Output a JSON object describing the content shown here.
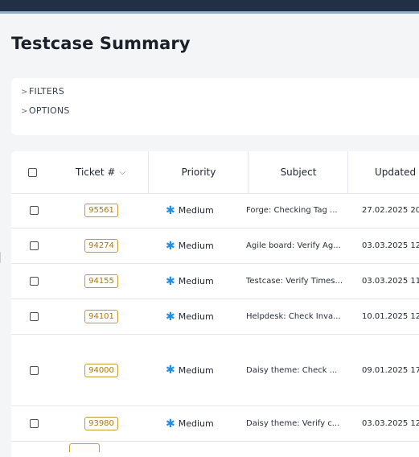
{
  "page": {
    "title": "Testcase Summary"
  },
  "filters": {
    "filters_label": "FILTERS",
    "options_label": "OPTIONS",
    "chevron": ">"
  },
  "table": {
    "columns": {
      "ticket": "Ticket #",
      "priority": "Priority",
      "subject": "Subject",
      "updated": "Updated"
    },
    "sort_icon": "chevron-down-icon",
    "rows": [
      {
        "ticket": "95561",
        "priority": "Medium",
        "subject": "Forge: Checking Tag ...",
        "updated": "27.02.2025 20"
      },
      {
        "ticket": "94274",
        "priority": "Medium",
        "subject": "Agile board: Verify Ag...",
        "updated": "03.03.2025 12"
      },
      {
        "ticket": "94155",
        "priority": "Medium",
        "subject": "Testcase: Verify Times...",
        "updated": "03.03.2025 11:"
      },
      {
        "ticket": "94101",
        "priority": "Medium",
        "subject": "Helpdesk: Check Inva...",
        "updated": "10.01.2025 12:"
      },
      {
        "ticket": "94000",
        "priority": "Medium",
        "subject": "Daisy theme: Check ...",
        "updated": "09.01.2025 17:"
      },
      {
        "ticket": "93980",
        "priority": "Medium",
        "subject": "Daisy theme: Verify c...",
        "updated": "03.03.2025 12"
      }
    ]
  },
  "colors": {
    "priority_icon": "#1f8fe6",
    "ticket_badge": "#c49a3c",
    "topbar": "#223045"
  }
}
